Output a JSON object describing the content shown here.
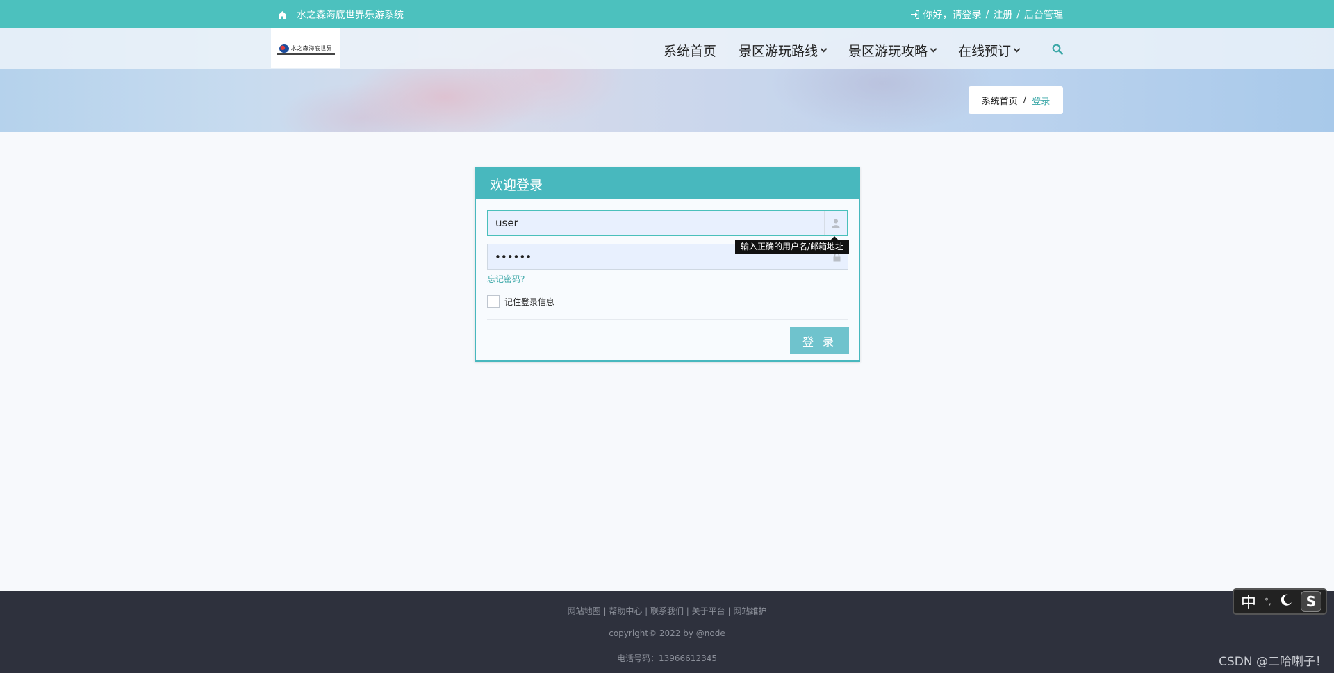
{
  "topbar": {
    "site_name": "水之森海底世界乐游系统",
    "greeting": "你好，请登录",
    "sep1": "/",
    "register": "注册",
    "sep2": "/",
    "admin": "后台管理"
  },
  "nav": {
    "logo_text": "水之森海底世界",
    "menu": [
      {
        "label": "系统首页",
        "dropdown": false
      },
      {
        "label": "景区游玩路线",
        "dropdown": true
      },
      {
        "label": "景区游玩攻略",
        "dropdown": true
      },
      {
        "label": "在线预订",
        "dropdown": true
      }
    ]
  },
  "breadcrumb": {
    "home": "系统首页",
    "sep": "/",
    "current": "登录"
  },
  "login": {
    "title": "欢迎登录",
    "username_value": "user",
    "password_value": "••••••",
    "tooltip": "输入正确的用户名/邮箱地址",
    "forgot": "忘记密码?",
    "remember": "记住登录信息",
    "submit": "登 录"
  },
  "footer": {
    "links": "网站地图 | 帮助中心 | 联系我们 | 关于平台 | 网站维护",
    "copyright": "copyright© 2022 by @node",
    "phone": "电话号码：13966612345"
  },
  "ime": {
    "mode": "中",
    "punct": "°,"
  },
  "watermark": "CSDN @二哈喇子！",
  "colors": {
    "accent": "#4cc1be",
    "panel": "#48b8be",
    "footer": "#2e313d",
    "button": "#6fc3cd"
  }
}
